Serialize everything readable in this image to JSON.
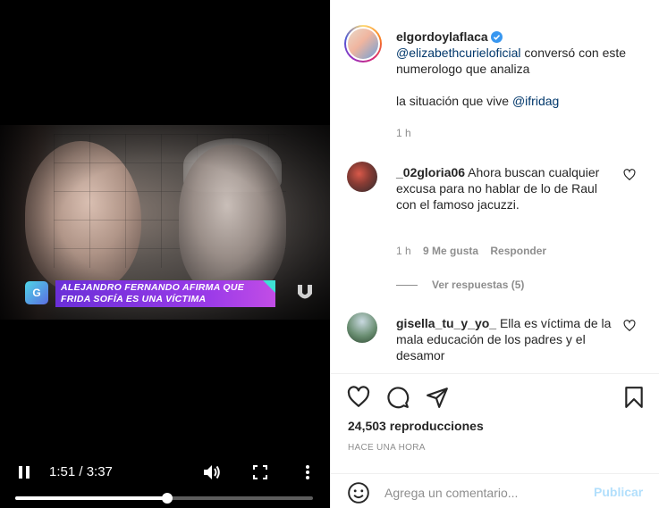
{
  "video": {
    "headline_line1": "ALEJANDRO FERNANDO AFIRMA QUE",
    "headline_line2": "FRIDA SOFÍA ES UNA VÍCTIMA",
    "show_logo": "G",
    "time_display": "1:51 / 3:37",
    "progress": 0.51,
    "icons": [
      "pause-icon",
      "volume-icon",
      "fullscreen-icon",
      "more-vertical-icon"
    ]
  },
  "post": {
    "username": "elgordoylaflaca",
    "verified": true,
    "caption_mention": "@elizabethcurieloficial",
    "caption_text": " conversó con este numerologo que analiza",
    "caption_line2_text": "la situación que vive ",
    "caption_line2_mention": "@ifridag",
    "time": "1 h"
  },
  "comments": [
    {
      "username": "_02gloria06",
      "text": " Ahora buscan cualquier excusa para no hablar de lo de Raul con el famoso jacuzzi.",
      "time": "1 h",
      "likes": "9 Me gusta",
      "reply_label": "Responder",
      "view_replies": "Ver respuestas (5)"
    },
    {
      "username": "gisella_tu_y_yo_",
      "text": "  Ella es víctima de la mala educación de los padres y el desamor"
    }
  ],
  "actions": {
    "views": "24,503 reproducciones",
    "posted": "HACE UNA HORA",
    "icons": [
      "heart-icon",
      "comment-icon",
      "share-icon",
      "bookmark-icon"
    ]
  },
  "add_comment": {
    "placeholder": "Agrega un comentario...",
    "publish_label": "Publicar"
  },
  "colors": {
    "mention": "#00376b",
    "meta": "#8e8e8e",
    "publish_disabled": "#b2dffc",
    "verified": "#3897f0",
    "headline_bar": "#9b3be8"
  }
}
